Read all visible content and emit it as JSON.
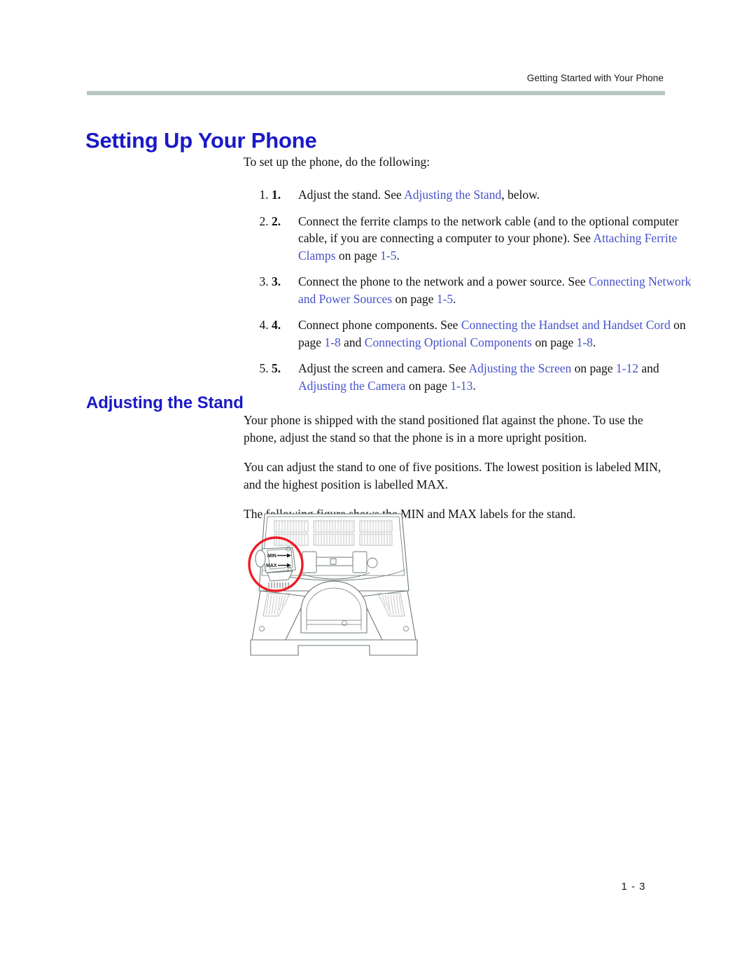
{
  "header": {
    "running_head": "Getting Started with Your Phone",
    "rule_color": "#b9c7c3"
  },
  "chapter": {
    "title": "Setting Up Your Phone",
    "title_color": "#1a19c7"
  },
  "intro": "To set up the phone, do the following:",
  "steps": [
    {
      "number": "1.",
      "segments": [
        {
          "text": "Adjust the stand. See ",
          "style": "plain"
        },
        {
          "text": "Adjusting the Stand",
          "style": "xref"
        },
        {
          "text": ", below.",
          "style": "plain"
        }
      ]
    },
    {
      "number": "2.",
      "segments": [
        {
          "text": "Connect the ferrite clamps to the network cable (and to the optional computer cable, if you are connecting a computer to your phone). See ",
          "style": "plain"
        },
        {
          "text": "Attaching Ferrite Clamps",
          "style": "xref"
        },
        {
          "text": " on page ",
          "style": "plain"
        },
        {
          "text": "1-5",
          "style": "xref"
        },
        {
          "text": ".",
          "style": "plain"
        }
      ]
    },
    {
      "number": "3.",
      "segments": [
        {
          "text": "Connect the phone to the network and a power source. See ",
          "style": "plain"
        },
        {
          "text": "Connecting Network and Power Sources",
          "style": "xref"
        },
        {
          "text": " on page ",
          "style": "plain"
        },
        {
          "text": "1-5",
          "style": "xref"
        },
        {
          "text": ".",
          "style": "plain"
        }
      ]
    },
    {
      "number": "4.",
      "segments": [
        {
          "text": "Connect phone components. See ",
          "style": "plain"
        },
        {
          "text": "Connecting the Handset and Handset Cord",
          "style": "xref"
        },
        {
          "text": " on page ",
          "style": "plain"
        },
        {
          "text": "1-8",
          "style": "xref"
        },
        {
          "text": " and ",
          "style": "plain"
        },
        {
          "text": "Connecting Optional Components",
          "style": "xref"
        },
        {
          "text": " on page ",
          "style": "plain"
        },
        {
          "text": "1-8",
          "style": "xref"
        },
        {
          "text": ".",
          "style": "plain"
        }
      ]
    },
    {
      "number": "5.",
      "segments": [
        {
          "text": "Adjust the screen and camera. See ",
          "style": "plain"
        },
        {
          "text": "Adjusting the Screen",
          "style": "xref"
        },
        {
          "text": " on page ",
          "style": "plain"
        },
        {
          "text": "1-12",
          "style": "xref"
        },
        {
          "text": " and ",
          "style": "plain"
        },
        {
          "text": "Adjusting the Camera",
          "style": "xref"
        },
        {
          "text": " on page ",
          "style": "plain"
        },
        {
          "text": "1-13",
          "style": "xref"
        },
        {
          "text": ".",
          "style": "plain"
        }
      ]
    }
  ],
  "section": {
    "heading": "Adjusting the Stand",
    "paragraphs": [
      "Your phone is shipped with the stand positioned flat against the phone. To use the phone, adjust the stand so that the phone is in a more upright position.",
      "You can adjust the stand to one of five positions. The lowest position is labeled MIN, and the highest position is labelled MAX.",
      "The following figure shows the MIN and MAX labels for the stand."
    ]
  },
  "figure": {
    "name": "phone-stand-rear-view",
    "callout_color": "#ee1c25",
    "line_color": "#6b7a76",
    "labels": {
      "min": "MIN",
      "max": "MAX"
    }
  },
  "footer": {
    "page_number": "1 - 3"
  },
  "colors": {
    "heading_blue": "#1a19c7",
    "xref_blue": "#4652c9",
    "rule": "#b9c7c3",
    "body_text": "#111111"
  }
}
